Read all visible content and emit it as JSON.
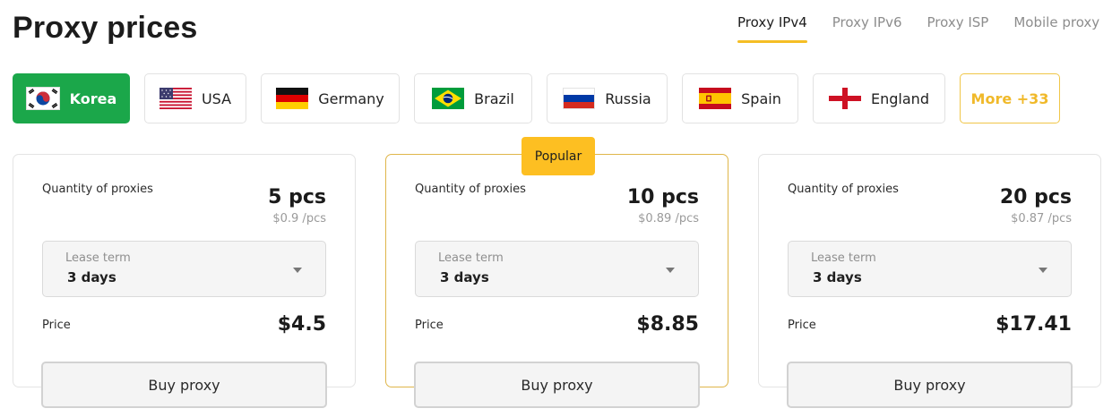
{
  "page_title": "Proxy prices",
  "tabs": [
    {
      "label": "Proxy IPv4",
      "active": true
    },
    {
      "label": "Proxy IPv6",
      "active": false
    },
    {
      "label": "Proxy ISP",
      "active": false
    },
    {
      "label": "Mobile proxy",
      "active": false
    }
  ],
  "countries": [
    {
      "label": "Korea",
      "icon": "korea-flag-icon",
      "active": true
    },
    {
      "label": "USA",
      "icon": "usa-flag-icon"
    },
    {
      "label": "Germany",
      "icon": "germany-flag-icon"
    },
    {
      "label": "Brazil",
      "icon": "brazil-flag-icon"
    },
    {
      "label": "Russia",
      "icon": "russia-flag-icon"
    },
    {
      "label": "Spain",
      "icon": "spain-flag-icon"
    },
    {
      "label": "England",
      "icon": "england-flag-icon"
    },
    {
      "label": "More +33"
    }
  ],
  "colors": {
    "accent_green": "#1ba74a",
    "accent_yellow": "#fdbf22"
  },
  "cards": [
    {
      "quantity_label": "Quantity of proxies",
      "quantity": "5 pcs",
      "unit_price": "$0.9 /pcs",
      "lease_label": "Lease term",
      "lease_value": "3 days",
      "price_label": "Price",
      "price": "$4.5",
      "buy_label": "Buy proxy"
    },
    {
      "badge": "Popular",
      "quantity_label": "Quantity of proxies",
      "quantity": "10 pcs",
      "unit_price": "$0.89 /pcs",
      "lease_label": "Lease term",
      "lease_value": "3 days",
      "price_label": "Price",
      "price": "$8.85",
      "buy_label": "Buy proxy"
    },
    {
      "quantity_label": "Quantity of proxies",
      "quantity": "20 pcs",
      "unit_price": "$0.87 /pcs",
      "lease_label": "Lease term",
      "lease_value": "3 days",
      "price_label": "Price",
      "price": "$17.41",
      "buy_label": "Buy proxy"
    }
  ]
}
